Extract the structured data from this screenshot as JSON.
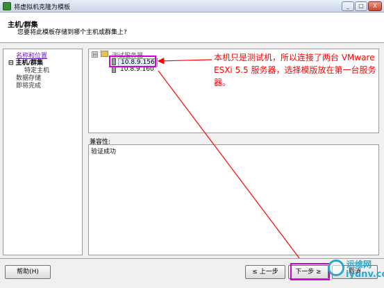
{
  "window": {
    "title": "将虚拟机克隆为模板",
    "min_label": "_",
    "max_label": "□",
    "close_label": "X"
  },
  "header": {
    "title": "主机/群集",
    "subtitle": "您要将此模板存储到哪个主机或群集上?"
  },
  "steps": [
    {
      "label": "名称和位置"
    },
    {
      "label": "⊟ 主机/群集"
    },
    {
      "label": "特定主机"
    },
    {
      "label": "数据存储"
    },
    {
      "label": "即将完成"
    }
  ],
  "tree": {
    "collapse_symbol": "⊟",
    "root_label": "测试服务器",
    "hosts": [
      {
        "label": "10.8.9.156"
      },
      {
        "label": "10.8.9.160"
      }
    ]
  },
  "compatibility": {
    "label": "兼容性:",
    "text": "验证成功"
  },
  "annotation": {
    "text": "本机只是测试机，所以连接了两台 VMware ESXi 5.5 服务器，选择模版放在第一台服务器。",
    "color": "#ff0000"
  },
  "footer": {
    "help_label": "帮助(H)",
    "back_label": "≤ 上一步",
    "next_label": "下一步 ≥",
    "cancel_label": "取消"
  },
  "watermark": {
    "line1": "运维网",
    "line2": "iyunv.com"
  },
  "colors": {
    "highlight": "#d100d1",
    "arrow": "#ff0000",
    "watermark": "#28a8d0"
  }
}
